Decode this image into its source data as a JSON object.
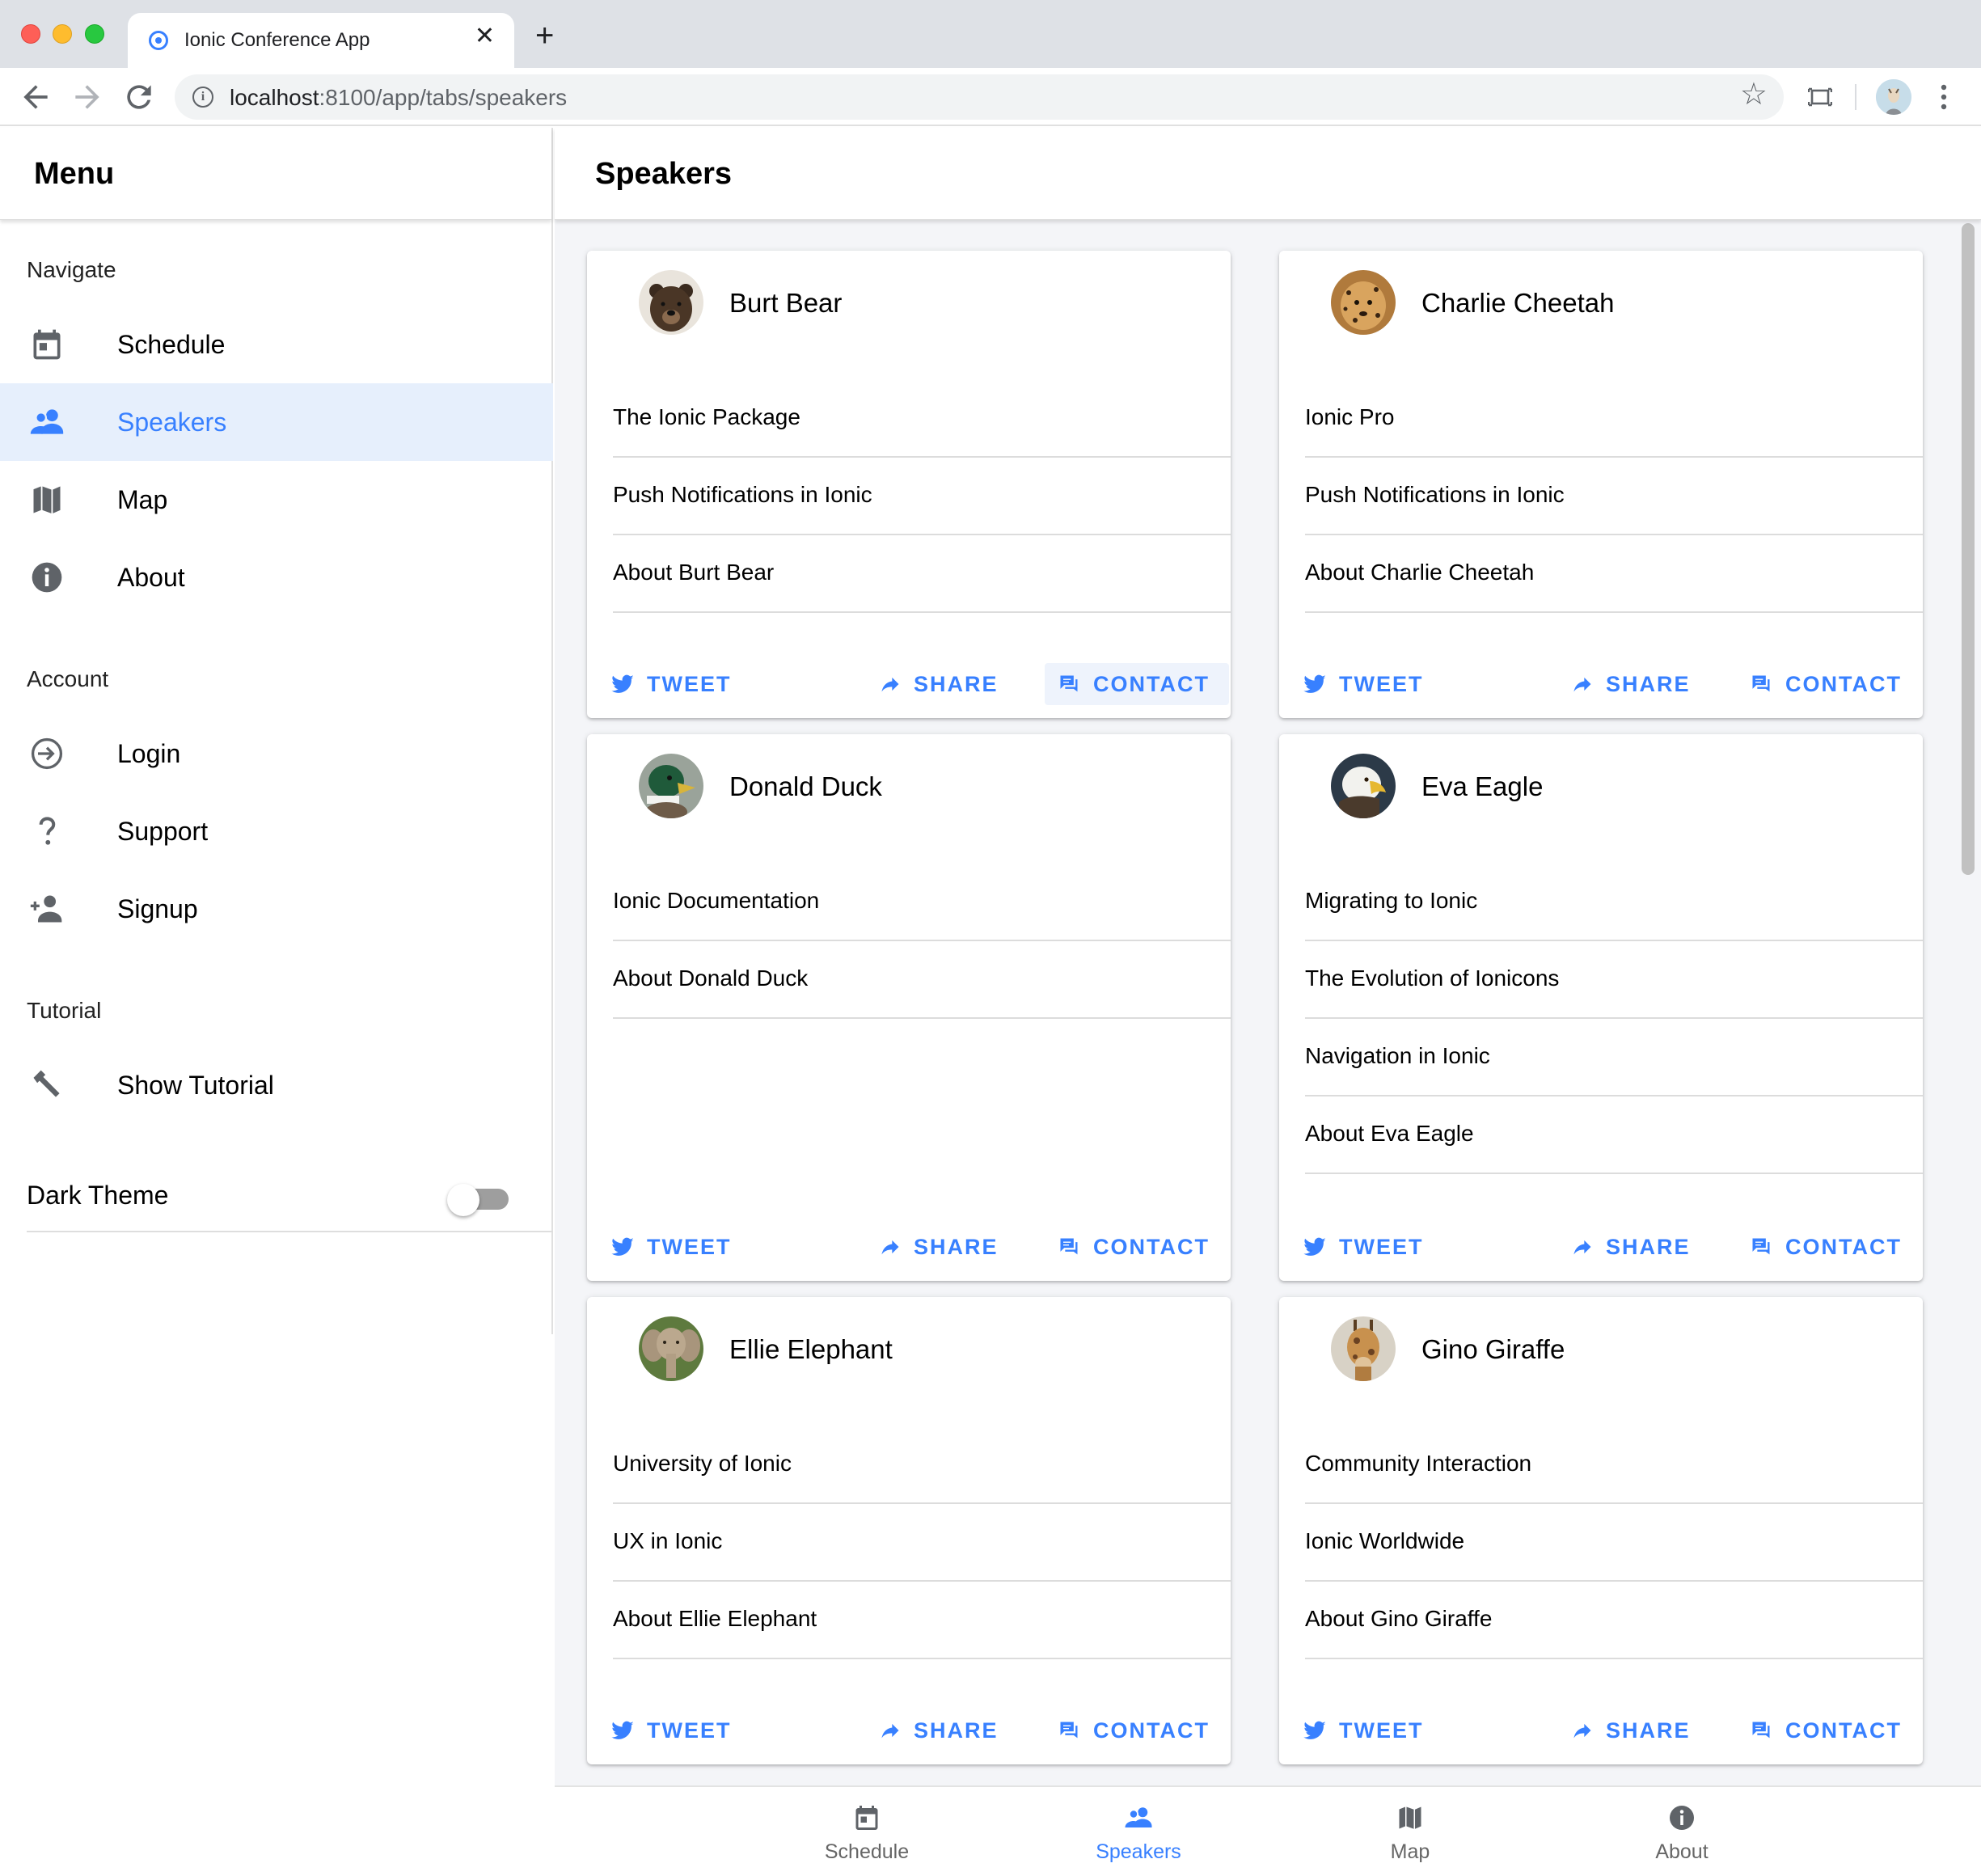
{
  "browser": {
    "tab_title": "Ionic Conference App",
    "url_host": "localhost",
    "url_path": ":8100/app/tabs/speakers"
  },
  "menu": {
    "title": "Menu",
    "sections": {
      "navigate": "Navigate",
      "account": "Account",
      "tutorial": "Tutorial"
    },
    "items": [
      {
        "label": "Schedule",
        "icon": "calendar-icon"
      },
      {
        "label": "Speakers",
        "icon": "people-icon",
        "selected": true
      },
      {
        "label": "Map",
        "icon": "map-icon"
      },
      {
        "label": "About",
        "icon": "info-icon"
      },
      {
        "label": "Login",
        "icon": "login-icon"
      },
      {
        "label": "Support",
        "icon": "help-icon"
      },
      {
        "label": "Signup",
        "icon": "person-add-icon"
      },
      {
        "label": "Show Tutorial",
        "icon": "hammer-icon"
      }
    ],
    "dark_theme": {
      "label": "Dark Theme",
      "enabled": false
    }
  },
  "page": {
    "title": "Speakers"
  },
  "actions": {
    "tweet": "TWEET",
    "share": "SHARE",
    "contact": "CONTACT"
  },
  "speakers": [
    {
      "name": "Burt Bear",
      "talks": [
        "The Ionic Package",
        "Push Notifications in Ionic",
        "About Burt Bear"
      ]
    },
    {
      "name": "Charlie Cheetah",
      "talks": [
        "Ionic Pro",
        "Push Notifications in Ionic",
        "About Charlie Cheetah"
      ]
    },
    {
      "name": "Donald Duck",
      "talks": [
        "Ionic Documentation",
        "About Donald Duck"
      ]
    },
    {
      "name": "Eva Eagle",
      "talks": [
        "Migrating to Ionic",
        "The Evolution of Ionicons",
        "Navigation in Ionic",
        "About Eva Eagle"
      ]
    },
    {
      "name": "Ellie Elephant",
      "talks": [
        "University of Ionic",
        "UX in Ionic",
        "About Ellie Elephant"
      ]
    },
    {
      "name": "Gino Giraffe",
      "talks": [
        "Community Interaction",
        "Ionic Worldwide",
        "About Gino Giraffe"
      ]
    }
  ],
  "tabs": [
    {
      "label": "Schedule",
      "icon": "calendar-icon"
    },
    {
      "label": "Speakers",
      "icon": "people-icon",
      "active": true
    },
    {
      "label": "Map",
      "icon": "map-icon"
    },
    {
      "label": "About",
      "icon": "info-icon"
    }
  ],
  "colors": {
    "primary": "#3880ff",
    "selected_bg": "#e6effc",
    "content_bg": "#f4f5f8"
  }
}
